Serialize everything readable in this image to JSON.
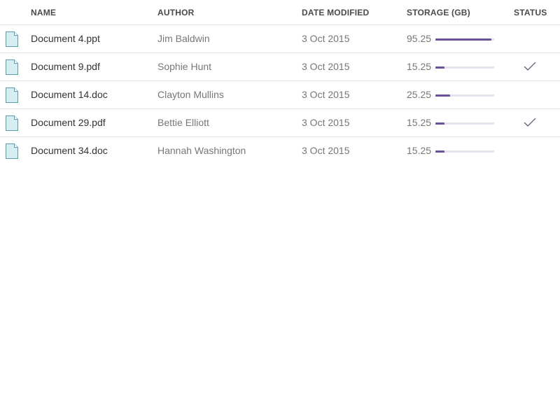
{
  "headers": {
    "name": "NAME",
    "author": "AUTHOR",
    "date": "DATE MODIFIED",
    "storage": "STORAGE (GB)",
    "status": "STATUS"
  },
  "colors": {
    "accent": "#6a5299",
    "track": "#e4e2ec",
    "icon_fill": "#d6eef2",
    "icon_stroke": "#5b9eb2",
    "check": "#5a6478"
  },
  "rows": [
    {
      "name": "Document 4.ppt",
      "author": "Jim Baldwin",
      "date": "3 Oct 2015",
      "storage": "95.25",
      "usage_fraction": 0.95,
      "status_icon": "none"
    },
    {
      "name": "Document 9.pdf",
      "author": "Sophie Hunt",
      "date": "3 Oct 2015",
      "storage": "15.25",
      "usage_fraction": 0.15,
      "status_icon": "check-icon"
    },
    {
      "name": "Document 14.doc",
      "author": "Clayton Mullins",
      "date": "3 Oct 2015",
      "storage": "25.25",
      "usage_fraction": 0.25,
      "status_icon": "none"
    },
    {
      "name": "Document 29.pdf",
      "author": "Bettie Elliott",
      "date": "3 Oct 2015",
      "storage": "15.25",
      "usage_fraction": 0.15,
      "status_icon": "check-icon"
    },
    {
      "name": "Document 34.doc",
      "author": "Hannah Washington",
      "date": "3 Oct 2015",
      "storage": "15.25",
      "usage_fraction": 0.15,
      "status_icon": "none"
    }
  ]
}
